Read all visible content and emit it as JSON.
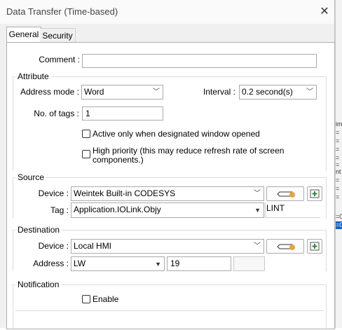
{
  "dialog": {
    "title": "Data Transfer (Time-based)"
  },
  "tabs": [
    {
      "label": "General"
    },
    {
      "label": "Security"
    }
  ],
  "comment": {
    "label": "Comment :",
    "value": ""
  },
  "attribute": {
    "title": "Attribute",
    "address_mode_label": "Address mode :",
    "address_mode_value": "Word",
    "interval_label": "Interval :",
    "interval_value": "0.2 second(s)",
    "num_tags_label": "No. of tags :",
    "num_tags_value": "1",
    "active_only_label": "Active only when designated window opened",
    "high_priority_line1": "High priority (this may reduce refresh rate of screen",
    "high_priority_line2": "components.)"
  },
  "source": {
    "title": "Source",
    "device_label": "Device :",
    "device_value": "Weintek Built-in CODESYS",
    "tag_label": "Tag :",
    "tag_value": "Application.IOLink.Objy",
    "type_value": "LINT"
  },
  "destination": {
    "title": "Destination",
    "device_label": "Device :",
    "device_value": "Local HMI",
    "address_label": "Address :",
    "address_type": "LW",
    "address_value": "19",
    "address_extra": ""
  },
  "notification": {
    "title": "Notification",
    "enable_label": "Enable"
  },
  "background_app": {
    "cells": [
      "im",
      "=",
      "=",
      "=",
      "=",
      "=",
      "nt",
      "=",
      "=",
      "=",
      "=0",
      "=0"
    ]
  },
  "colors": {
    "selection": "#0a64d8",
    "accent_orange": "#e8a33d",
    "accent_green": "#2e8b3a"
  }
}
